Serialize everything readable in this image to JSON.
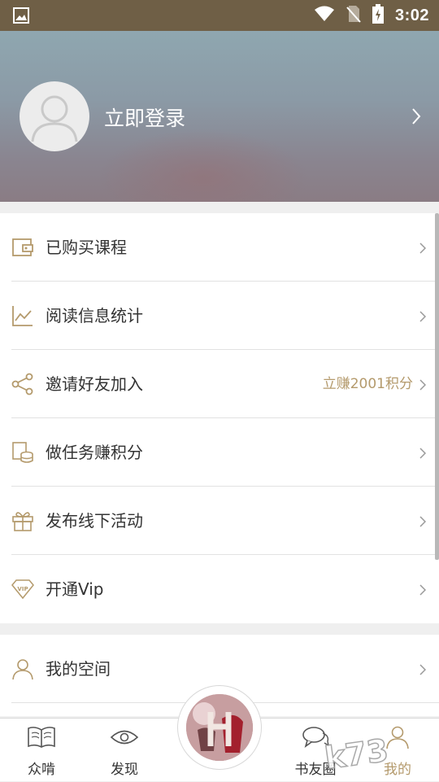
{
  "status_bar": {
    "time": "3:02"
  },
  "header": {
    "login_text": "立即登录"
  },
  "menu": {
    "items": [
      {
        "label": "已购买课程",
        "icon": "wallet-icon"
      },
      {
        "label": "阅读信息统计",
        "icon": "chart-line-icon"
      },
      {
        "label": "邀请好友加入",
        "icon": "share-icon",
        "extra": "立赚2001积分"
      },
      {
        "label": "做任务赚积分",
        "icon": "coins-icon"
      },
      {
        "label": "发布线下活动",
        "icon": "gift-icon"
      },
      {
        "label": "开通Vip",
        "icon": "vip-diamond-icon"
      }
    ],
    "items2": [
      {
        "label": "我的空间",
        "icon": "user-icon"
      }
    ]
  },
  "tabbar": {
    "tabs": [
      {
        "label": "众啃",
        "icon": "book-icon"
      },
      {
        "label": "发现",
        "icon": "eye-icon"
      },
      {
        "label": "书友圈",
        "icon": "chat-bubbles-icon"
      },
      {
        "label": "我的",
        "icon": "user-icon"
      }
    ]
  },
  "colors": {
    "accent": "#b49a6c",
    "status_bar": "#6f5f46",
    "text": "#333333"
  }
}
